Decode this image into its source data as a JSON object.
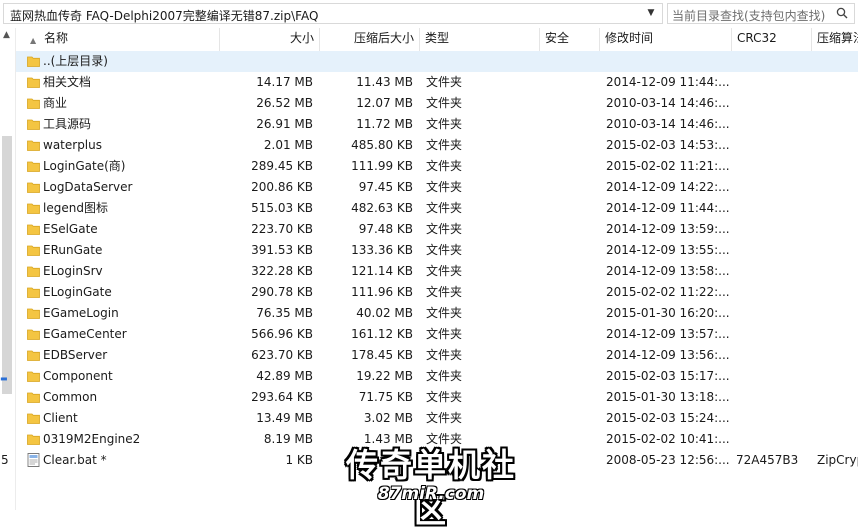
{
  "address_bar": {
    "path": "蓝网热血传奇 FAQ-Delphi2007完整编译无错87.zip\\FAQ",
    "search_placeholder": "当前目录查找(支持包内查找)"
  },
  "left_pane": {
    "partial_text": "5"
  },
  "columns": [
    "名称",
    "大小",
    "压缩后大小",
    "类型",
    "安全",
    "修改时间",
    "CRC32",
    "压缩算法"
  ],
  "parent_row": {
    "name": "..(上层目录)"
  },
  "rows": [
    {
      "name": "相关文档",
      "size": "14.17 MB",
      "packed": "11.43 MB",
      "type": "文件夹",
      "security": "",
      "modified": "2014-12-09 11:44:...",
      "crc": "",
      "method": "",
      "icon": "folder-icon"
    },
    {
      "name": "商业",
      "size": "26.52 MB",
      "packed": "12.07 MB",
      "type": "文件夹",
      "security": "",
      "modified": "2010-03-14 14:46:...",
      "crc": "",
      "method": "",
      "icon": "folder-icon"
    },
    {
      "name": "工具源码",
      "size": "26.91 MB",
      "packed": "11.72 MB",
      "type": "文件夹",
      "security": "",
      "modified": "2010-03-14 14:46:...",
      "crc": "",
      "method": "",
      "icon": "folder-icon"
    },
    {
      "name": "waterplus",
      "size": "2.01 MB",
      "packed": "485.80 KB",
      "type": "文件夹",
      "security": "",
      "modified": "2015-02-03 14:53:...",
      "crc": "",
      "method": "",
      "icon": "folder-icon"
    },
    {
      "name": "LoginGate(商)",
      "size": "289.45 KB",
      "packed": "111.99 KB",
      "type": "文件夹",
      "security": "",
      "modified": "2015-02-02 11:21:...",
      "crc": "",
      "method": "",
      "icon": "folder-icon"
    },
    {
      "name": "LogDataServer",
      "size": "200.86 KB",
      "packed": "97.45 KB",
      "type": "文件夹",
      "security": "",
      "modified": "2014-12-09 14:22:...",
      "crc": "",
      "method": "",
      "icon": "folder-icon"
    },
    {
      "name": "legend图标",
      "size": "515.03 KB",
      "packed": "482.63 KB",
      "type": "文件夹",
      "security": "",
      "modified": "2014-12-09 11:44:...",
      "crc": "",
      "method": "",
      "icon": "folder-icon"
    },
    {
      "name": "ESelGate",
      "size": "223.70 KB",
      "packed": "97.48 KB",
      "type": "文件夹",
      "security": "",
      "modified": "2014-12-09 13:59:...",
      "crc": "",
      "method": "",
      "icon": "folder-icon"
    },
    {
      "name": "ERunGate",
      "size": "391.53 KB",
      "packed": "133.36 KB",
      "type": "文件夹",
      "security": "",
      "modified": "2014-12-09 13:55:...",
      "crc": "",
      "method": "",
      "icon": "folder-icon"
    },
    {
      "name": "ELoginSrv",
      "size": "322.28 KB",
      "packed": "121.14 KB",
      "type": "文件夹",
      "security": "",
      "modified": "2014-12-09 13:58:...",
      "crc": "",
      "method": "",
      "icon": "folder-icon"
    },
    {
      "name": "ELoginGate",
      "size": "290.78 KB",
      "packed": "111.96 KB",
      "type": "文件夹",
      "security": "",
      "modified": "2015-02-02 11:22:...",
      "crc": "",
      "method": "",
      "icon": "folder-icon"
    },
    {
      "name": "EGameLogin",
      "size": "76.35 MB",
      "packed": "40.02 MB",
      "type": "文件夹",
      "security": "",
      "modified": "2015-01-30 16:20:...",
      "crc": "",
      "method": "",
      "icon": "folder-icon"
    },
    {
      "name": "EGameCenter",
      "size": "566.96 KB",
      "packed": "161.12 KB",
      "type": "文件夹",
      "security": "",
      "modified": "2014-12-09 13:57:...",
      "crc": "",
      "method": "",
      "icon": "folder-icon"
    },
    {
      "name": "EDBServer",
      "size": "623.70 KB",
      "packed": "178.45 KB",
      "type": "文件夹",
      "security": "",
      "modified": "2014-12-09 13:56:...",
      "crc": "",
      "method": "",
      "icon": "folder-icon"
    },
    {
      "name": "Component",
      "size": "42.89 MB",
      "packed": "19.22 MB",
      "type": "文件夹",
      "security": "",
      "modified": "2015-02-03 15:17:...",
      "crc": "",
      "method": "",
      "icon": "folder-icon"
    },
    {
      "name": "Common",
      "size": "293.64 KB",
      "packed": "71.75 KB",
      "type": "文件夹",
      "security": "",
      "modified": "2015-01-30 13:18:...",
      "crc": "",
      "method": "",
      "icon": "folder-icon"
    },
    {
      "name": "Client",
      "size": "13.49 MB",
      "packed": "3.02 MB",
      "type": "文件夹",
      "security": "",
      "modified": "2015-02-03 15:24:...",
      "crc": "",
      "method": "",
      "icon": "folder-icon"
    },
    {
      "name": "0319M2Engine2",
      "size": "8.19 MB",
      "packed": "1.43 MB",
      "type": "文件夹",
      "security": "",
      "modified": "2015-02-02 10:41:...",
      "crc": "",
      "method": "",
      "icon": "folder-icon"
    },
    {
      "name": "Clear.bat *",
      "size": "1 KB",
      "packed": "",
      "type": "",
      "security": "",
      "modified": "2008-05-23 12:56:...",
      "crc": "72A457B3",
      "method": "ZipCrypto",
      "icon": "file-icon"
    }
  ],
  "watermark": {
    "title": "传奇单机社区",
    "url": "87miR.com"
  },
  "colors": {
    "folder": "#f4c542",
    "selected_row": "#e5f1fb",
    "header_border": "#e5e5e5"
  }
}
